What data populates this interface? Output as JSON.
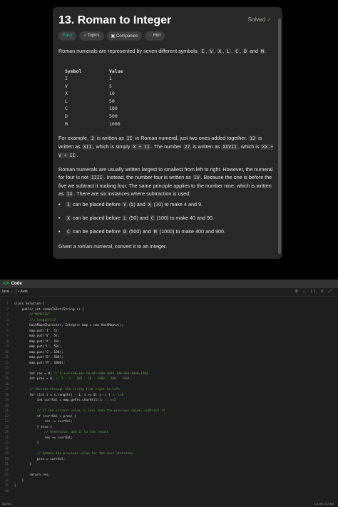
{
  "problem": {
    "title": "13. Roman to Integer",
    "status": "Solved",
    "tags": [
      "Easy",
      "Topics",
      "Companies",
      "Hint"
    ],
    "intro_prefix": "Roman numerals are represented by seven different symbols:",
    "intro_symbols": [
      "I",
      "V",
      "X",
      "L",
      "C",
      "D",
      "M"
    ],
    "table_headers": [
      "Symbol",
      "Value"
    ],
    "table_rows": [
      [
        "I",
        "1"
      ],
      [
        "V",
        "5"
      ],
      [
        "X",
        "10"
      ],
      [
        "L",
        "50"
      ],
      [
        "C",
        "100"
      ],
      [
        "D",
        "500"
      ],
      [
        "M",
        "1000"
      ]
    ],
    "para2": [
      "For example, ",
      "2",
      " is written as ",
      "II",
      " in Roman numeral, just two ones added together. ",
      "12",
      " is written as ",
      "XII",
      ", which is simply ",
      "X + II",
      ". The number ",
      "27",
      " is written as ",
      "XXVII",
      ", which is ",
      "XX + V + II",
      "."
    ],
    "para3": [
      "Roman numerals are usually written largest to smallest from left to right. However, the numeral for four is not ",
      "IIII",
      ". Instead, the number four is written as ",
      "IV",
      ". Because the one is before the five we subtract it making four. The same principle applies to the number nine, which is written as ",
      "IX",
      ". There are six instances where subtraction is used:"
    ],
    "cases": [
      [
        "I",
        " can be placed before ",
        "V",
        " (5) and ",
        "X",
        " (10) to make 4 and 9."
      ],
      [
        "X",
        " can be placed before ",
        "L",
        " (50) and ",
        "C",
        " (100) to make 40 and 90."
      ],
      [
        "C",
        " can be placed before ",
        "D",
        " (500) and ",
        "M",
        " (1000) to make 400 and 900."
      ]
    ],
    "closing": "Given a roman numeral, convert it to an integer."
  },
  "editor": {
    "header": "Code",
    "language": "Java",
    "mode": "Auto",
    "status_left": "Saved",
    "status_right": "Ln 29, Col 64",
    "lines": [
      "class Solution {",
      "    public int romanToInt(String s) {",
      "        //\"MCMXCIV\"",
      "        //s.length()=7",
      "        HashMap<Character, Integer> map = new HashMap<>();",
      "        map.put('I', 1);",
      "        map.put('V', 5);",
      "        map.put('X', 10);",
      "        map.put('L', 50);",
      "        map.put('C', 100);",
      "        map.put('D', 500);",
      "        map.put('M', 1000);",
      "",
      "        int res = 0; // 5-1=4+100=104-10=94+1000=1094-100=994+1000=1994",
      "        int prev = 0; // 5 - 1 - 100 - 10 - 1000 - 100 - 1000",
      "",
      "        // Iterate through the string from right to left",
      "        for (int i = s.length() - 1; i >= 0; i--) { // i=6",
      "            int currVal = map.get(s.charAt(i)); // v=5",
      "",
      "            // If the current value is less than the previous value, subtract it",
      "            if (currVal < prev) {",
      "                res -= currVal;",
      "            } else {",
      "                // Otherwise, add it to the result",
      "                res += currVal;",
      "            }",
      "",
      "            // Update the previous value for the next iteration",
      "            prev = currVal;",
      "        }",
      "",
      "        return res;",
      "    }",
      "}",
      ""
    ]
  }
}
